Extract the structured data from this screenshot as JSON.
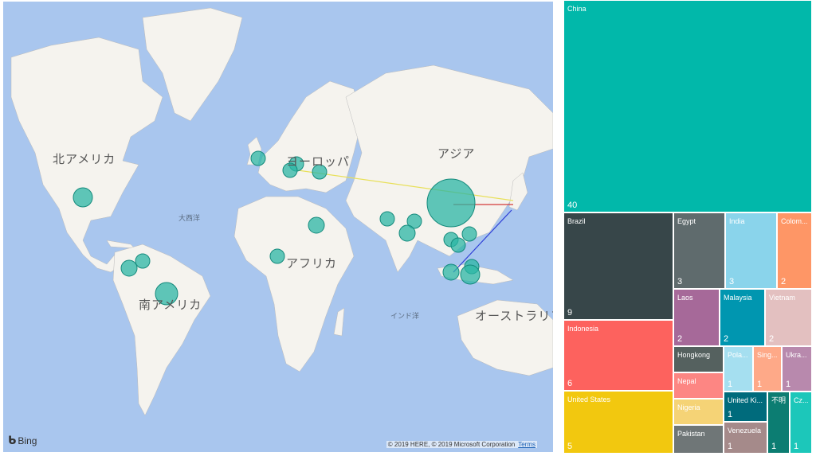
{
  "map": {
    "labels": {
      "north_america": "北アメリカ",
      "europe": "ヨーロッパ",
      "asia": "アジア",
      "atlantic": "大西洋",
      "africa": "アフリカ",
      "south_america": "南アメリカ",
      "indian_ocean": "インド洋",
      "oceania": "オーストラリア"
    },
    "bing": "Bing",
    "copyright": "© 2019 HERE, © 2019 Microsoft Corporation",
    "terms": "Terms",
    "colors": {
      "water": "#a9c6ee",
      "land": "#f5f3ee",
      "bubble": "#2bb5a4",
      "line_yellow": "#e8e05a",
      "line_red": "#d33a3a",
      "line_blue": "#2f3fd6"
    }
  },
  "treemap": {
    "tiles": [
      {
        "name": "China",
        "value": "40",
        "color": "#01b8aa"
      },
      {
        "name": "Brazil",
        "value": "9",
        "color": "#374649"
      },
      {
        "name": "Egypt",
        "value": "3",
        "color": "#5f6b6d"
      },
      {
        "name": "India",
        "value": "3",
        "color": "#8ad4eb"
      },
      {
        "name": "Colom...",
        "value": "2",
        "color": "#fe9666"
      },
      {
        "name": "Laos",
        "value": "2",
        "color": "#a66999"
      },
      {
        "name": "Malaysia",
        "value": "2",
        "color": "#0096b0"
      },
      {
        "name": "Vietnam",
        "value": "2",
        "color": "#e3c0c0"
      },
      {
        "name": "Indonesia",
        "value": "6",
        "color": "#fd625e"
      },
      {
        "name": "Hongkong",
        "value": "",
        "color": "#55615f"
      },
      {
        "name": "Pola...",
        "value": "1",
        "color": "#a5dff0"
      },
      {
        "name": "Sing...",
        "value": "1",
        "color": "#fea988"
      },
      {
        "name": "Ukra...",
        "value": "1",
        "color": "#b889ad"
      },
      {
        "name": "Nepal",
        "value": "",
        "color": "#fd8683"
      },
      {
        "name": "Nigeria",
        "value": "",
        "color": "#f5d376"
      },
      {
        "name": "United Ki...",
        "value": "1",
        "color": "#006b7c"
      },
      {
        "name": "不明",
        "value": "1",
        "color": "#0c7d72"
      },
      {
        "name": "Cz...",
        "value": "1",
        "color": "#1cc7ba"
      },
      {
        "name": "United States",
        "value": "5",
        "color": "#f2c80f"
      },
      {
        "name": "Pakistan",
        "value": "",
        "color": "#6f7677"
      },
      {
        "name": "Venezuela",
        "value": "1",
        "color": "#a58a8a"
      }
    ]
  }
}
